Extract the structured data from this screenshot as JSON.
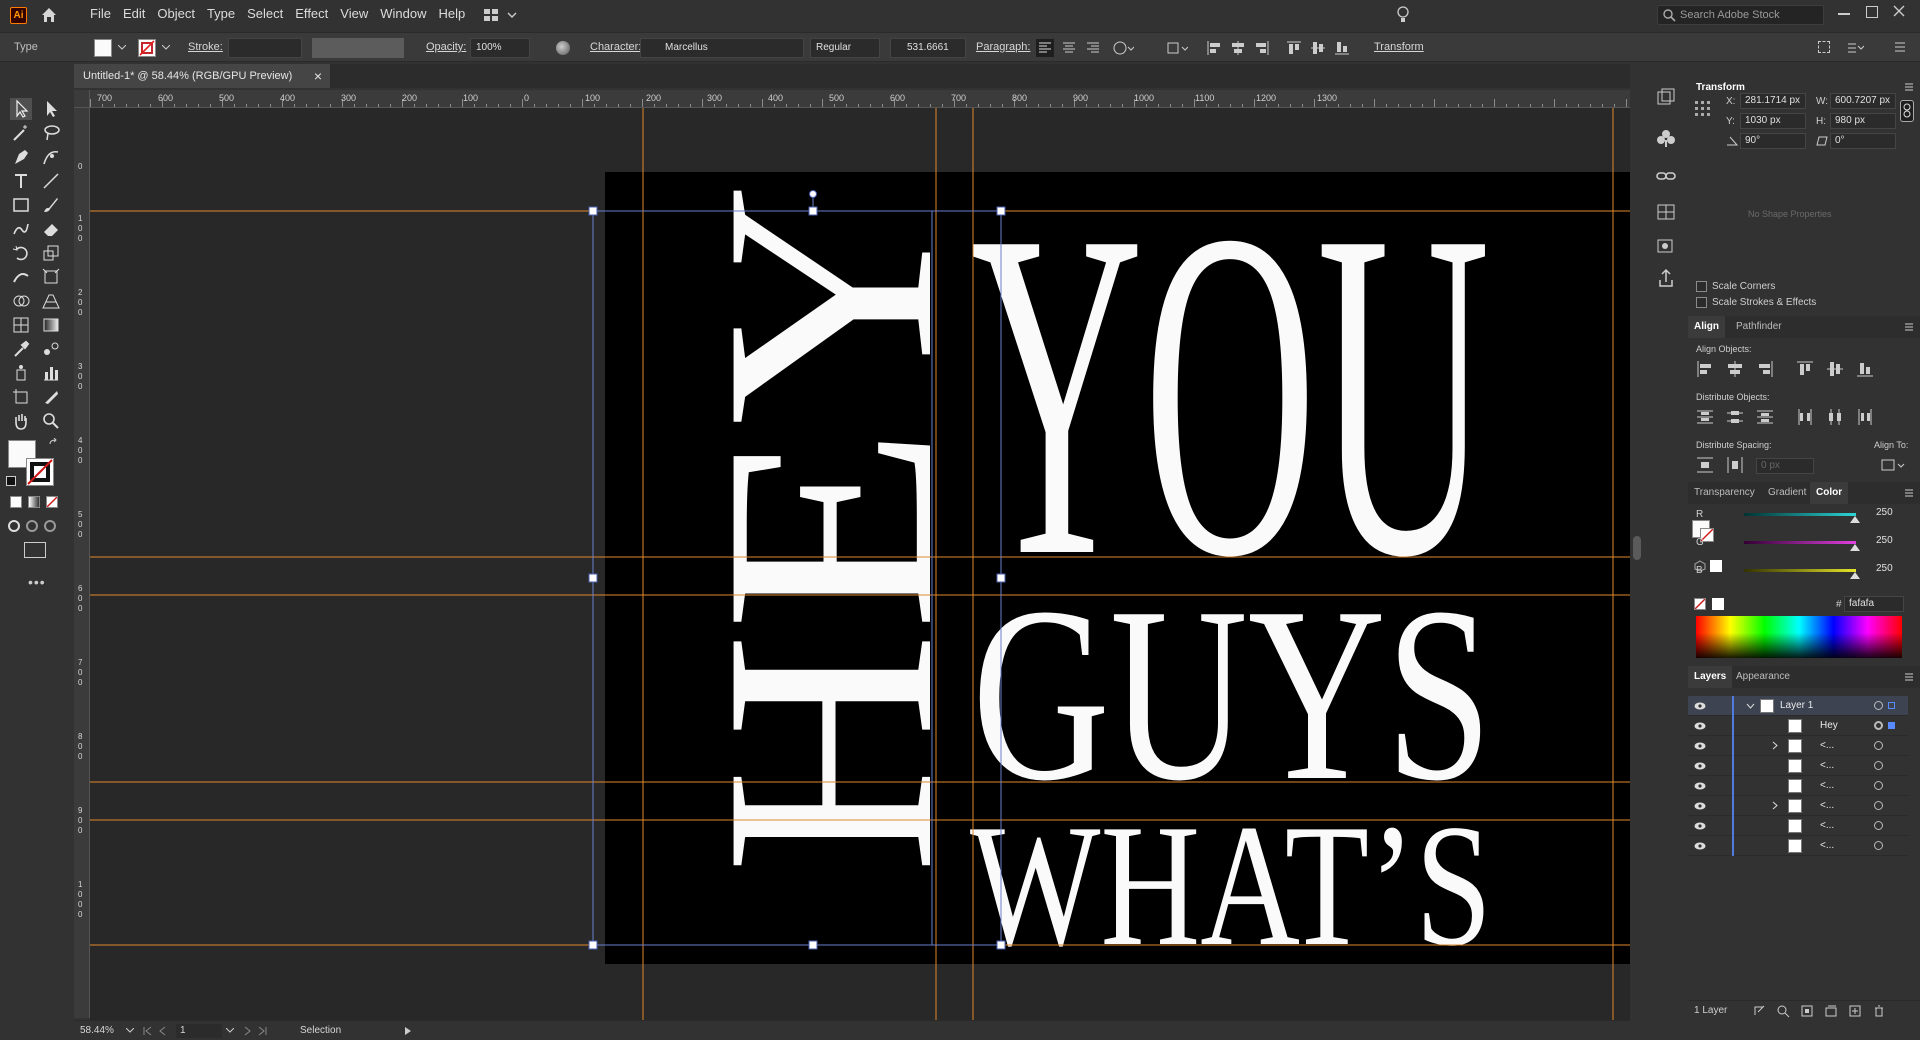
{
  "app": {
    "logo_text": "Ai"
  },
  "menu": [
    "File",
    "Edit",
    "Object",
    "Type",
    "Select",
    "Effect",
    "View",
    "Window",
    "Help"
  ],
  "search": {
    "placeholder": "Search Adobe Stock"
  },
  "control_bar": {
    "selection_type": "Type",
    "stroke_label": "Stroke:",
    "opacity_label": "Opacity:",
    "opacity_value": "100%",
    "character_label": "Character:",
    "font_family": "Marcellus",
    "font_style": "Regular",
    "font_size": "531.6661",
    "paragraph_label": "Paragraph:",
    "transform_label": "Transform"
  },
  "document_tab": {
    "title": "Untitled-1* @ 58.44% (RGB/GPU Preview)",
    "close": "×"
  },
  "ruler_top_labels": [
    "700",
    "600",
    "500",
    "400",
    "300",
    "200",
    "100",
    "0",
    "100",
    "200",
    "300",
    "400",
    "500",
    "600",
    "700",
    "800",
    "900",
    "1000",
    "1100",
    "1200",
    "1300"
  ],
  "ruler_left_labels": [
    "0",
    "1 0 0",
    "2 0 0",
    "3 0 0",
    "4 0 0",
    "5 0 0",
    "6 0 0",
    "7 0 0",
    "8 0 0",
    "9 0 0",
    "1 0 0 0"
  ],
  "artwork": {
    "vertical_text": "HEY",
    "lines": [
      "YOU",
      "GUYS",
      "WHAT’S"
    ],
    "background": "#000000",
    "text_color": "#fafafa",
    "guide_color": "#e0892a",
    "selection_color": "#6a7fd0"
  },
  "transform_panel": {
    "title": "Transform",
    "x_label": "X:",
    "x": "281.1714 px",
    "y_label": "Y:",
    "y": "1030 px",
    "w_label": "W:",
    "w": "600.7207 px",
    "h_label": "H:",
    "h": "980 px",
    "rotate": "90°",
    "shear": "0°",
    "no_shape": "No Shape Properties",
    "scale_corners": "Scale Corners",
    "scale_strokes": "Scale Strokes & Effects"
  },
  "align_panel": {
    "tabs": [
      "Align",
      "Pathfinder"
    ],
    "align_objects": "Align Objects:",
    "distribute_objects": "Distribute Objects:",
    "distribute_spacing": "Distribute Spacing:",
    "align_to": "Align To:",
    "spacing_value": "0 px"
  },
  "color_panel": {
    "tabs": [
      "Transparency",
      "Gradient",
      "Color"
    ],
    "channels": [
      {
        "label": "R",
        "value": "250",
        "color": "#29d4d4"
      },
      {
        "label": "G",
        "value": "250",
        "color": "#e040e0"
      },
      {
        "label": "B",
        "value": "250",
        "color": "#e6e62a"
      }
    ],
    "hex_label": "#",
    "hex": "fafafa"
  },
  "layers_panel": {
    "tabs": [
      "Layers",
      "Appearance"
    ],
    "rows": [
      {
        "name": "Layer 1",
        "expanded": true,
        "indent": 0
      },
      {
        "name": "Hey",
        "indent": 1
      },
      {
        "name": "<...",
        "indent": 1,
        "has_children": true
      },
      {
        "name": "<...",
        "indent": 1
      },
      {
        "name": "<...",
        "indent": 1
      },
      {
        "name": "<...",
        "indent": 1,
        "has_children": true
      },
      {
        "name": "<...",
        "indent": 1
      },
      {
        "name": "<...",
        "indent": 1
      }
    ],
    "footer": "1 Layer"
  },
  "status_bar": {
    "zoom": "58.44%",
    "artboard": "1",
    "tool": "Selection"
  }
}
